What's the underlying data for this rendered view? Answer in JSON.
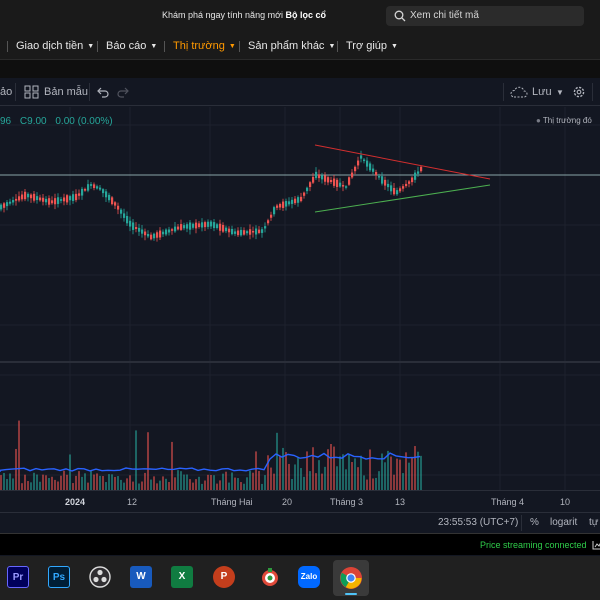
{
  "banner": {
    "text": "Khám phá ngay tính năng mới",
    "highlight": "Bộ lọc cổ",
    "search_placeholder": "Xem chi tiết mã"
  },
  "nav": {
    "items": [
      {
        "label": "Giao dịch tiền",
        "active": false
      },
      {
        "label": "Báo cáo",
        "active": false
      },
      {
        "label": "Thị trường",
        "active": true
      },
      {
        "label": "Sản phẩm khác",
        "active": false
      },
      {
        "label": "Trợ giúp",
        "active": false
      }
    ]
  },
  "toolbar": {
    "left_fragment": "ảo",
    "template_label": "Bản mẫu",
    "save_label": "Lưu"
  },
  "legend": {
    "prefix": "96",
    "change": "C9.00",
    "pct": "0.00 (0.00%)"
  },
  "market_status": "Thị trường đó",
  "time_axis": {
    "ticks": [
      {
        "label": "2024",
        "bold": true
      },
      {
        "label": "12",
        "bold": false
      },
      {
        "label": "Tháng Hai",
        "bold": false
      },
      {
        "label": "20",
        "bold": false
      },
      {
        "label": "Tháng 3",
        "bold": false
      },
      {
        "label": "13",
        "bold": false
      },
      {
        "label": "Tháng 4",
        "bold": false
      },
      {
        "label": "10",
        "bold": false
      }
    ]
  },
  "bottom": {
    "time": "23:55:53 (UTC+7)",
    "percent": "%",
    "log": "logarit",
    "auto": "tự"
  },
  "status": {
    "stream": "Price streaming connected"
  },
  "taskbar": {
    "apps": [
      "Pr",
      "Ps",
      "OBS",
      "W",
      "X",
      "P",
      "Bee",
      "Zalo",
      "Chrome"
    ]
  },
  "colors": {
    "up": "#26a69a",
    "down": "#ef5350",
    "accent": "#ff9900",
    "stream": "#2fcc4a"
  }
}
